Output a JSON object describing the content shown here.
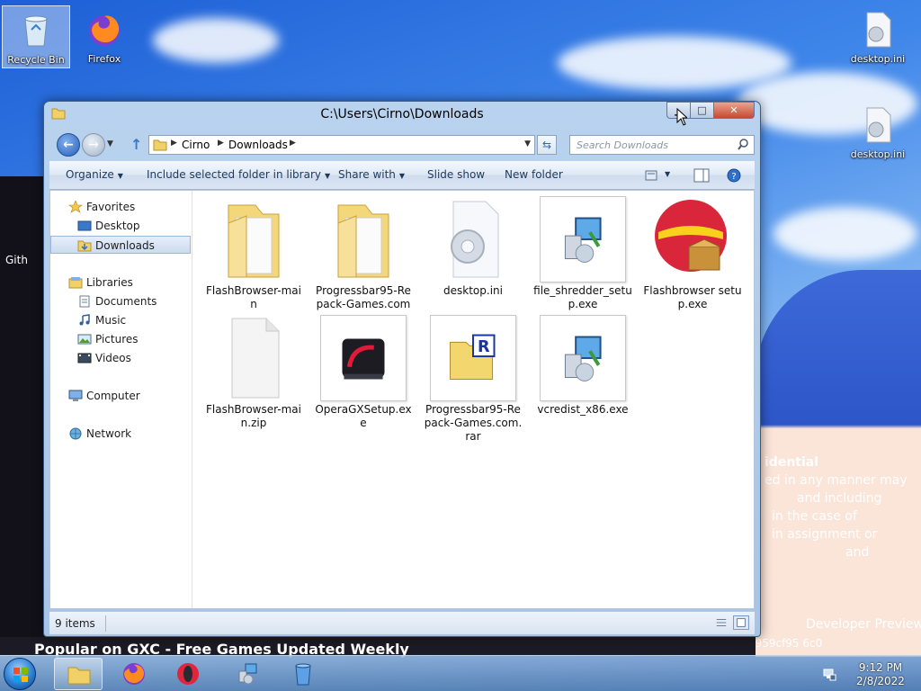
{
  "desktop": {
    "icons": [
      {
        "label": "Recycle Bin"
      },
      {
        "label": "Firefox"
      },
      {
        "label": "desktop.ini"
      },
      {
        "label": "desktop.ini"
      }
    ]
  },
  "background": {
    "browser_github": "Gith",
    "gxc_banner": "Popular on GXC - Free Games Updated Weekly",
    "wall_text_1": "idential",
    "wall_text_2": "ed in any manner may",
    "wall_text_3": "and including",
    "wall_text_4": "in the case of",
    "wall_text_5": "in assignment or",
    "wall_text_6": "and",
    "wall_text_7": "Developer Preview",
    "wall_text_8": "64.fbl_leap.11080 .959cf95 6c0"
  },
  "window": {
    "title": "C:\\Users\\Cirno\\Downloads",
    "address": [
      "Cirno",
      "Downloads"
    ],
    "search_placeholder": "Search Downloads",
    "toolbar": {
      "organize": "Organize",
      "include": "Include selected folder in library",
      "share": "Share with",
      "slideshow": "Slide show",
      "new_folder": "New folder"
    },
    "nav": {
      "favorites": "Favorites",
      "desktop": "Desktop",
      "downloads": "Downloads",
      "libraries": "Libraries",
      "documents": "Documents",
      "music": "Music",
      "pictures": "Pictures",
      "videos": "Videos",
      "computer": "Computer",
      "network": "Network"
    },
    "files": [
      {
        "name": "FlashBrowser-main"
      },
      {
        "name": "Progressbar95-Repack-Games.com"
      },
      {
        "name": "desktop.ini"
      },
      {
        "name": "file_shredder_setup.exe"
      },
      {
        "name": "Flashbrowser setup.exe"
      },
      {
        "name": "FlashBrowser-main.zip"
      },
      {
        "name": "OperaGXSetup.exe"
      },
      {
        "name": "Progressbar95-Repack-Games.com.rar"
      },
      {
        "name": "vcredist_x86.exe"
      }
    ],
    "status": "9 items"
  },
  "taskbar": {
    "time": "9:12 PM",
    "date": "2/8/2022"
  }
}
